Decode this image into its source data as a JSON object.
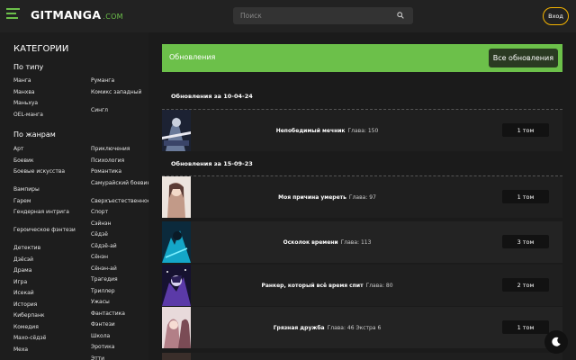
{
  "header": {
    "logo_main": "GITMANGA",
    "logo_suffix": ".COM",
    "search_placeholder": "Поиск",
    "login_label": "Вход"
  },
  "sidebar": {
    "title": "КАТЕГОРИИ",
    "by_type_title": "По типу",
    "by_type_left": [
      "Манга",
      "Манхва",
      "Маньхуа",
      "OEL-манга"
    ],
    "by_type_right": [
      "Руманга",
      "Комикс западный",
      "Сингл"
    ],
    "by_genre_title": "По жанрам",
    "genres_left": [
      "Арт",
      "Боевик",
      "Боевые искусства",
      "Вампиры",
      "Гарем",
      "Гендерная интрига",
      "Героическое фэнтези",
      "Детектив",
      "Дзёсэй",
      "Драма",
      "Игра",
      "Исекай",
      "История",
      "Киберпанк",
      "Комедия",
      "Махо-сёдзё",
      "Меха"
    ],
    "genres_right": [
      "Приключения",
      "Психология",
      "Романтика",
      "Самурайский боевик",
      "Сверхъестественное",
      "Спорт",
      "Сэйнэн",
      "Сёдзё",
      "Сёдзё-ай",
      "Сёнэн",
      "Сёнэн-ай",
      "Трагедия",
      "Триллер",
      "Ужасы",
      "Фантастика",
      "Фэнтези",
      "Школа",
      "Эротика",
      "Этти"
    ]
  },
  "main": {
    "updates_title": "Обновления",
    "all_updates_label": "Все обновления",
    "groups": [
      {
        "date_label": "Обновления за 10-04-24",
        "rows": [
          {
            "title": "Непобедимый мечник",
            "chapter_prefix": "Глава:",
            "chapter": "150",
            "volume": "1 том"
          }
        ]
      },
      {
        "date_label": "Обновления за 15-09-23",
        "rows": [
          {
            "title": "Моя причина умереть",
            "chapter_prefix": "Глава:",
            "chapter": "97",
            "volume": "1 том"
          },
          {
            "title": "Осколок времени",
            "chapter_prefix": "Глава:",
            "chapter": "113",
            "volume": "3 том"
          },
          {
            "title": "Ранкер, который всё время спит",
            "chapter_prefix": "Глава:",
            "chapter": "80",
            "volume": "2 том"
          },
          {
            "title": "Грязная дружба",
            "chapter_prefix": "Глава:",
            "chapter": "46 Экстра 6",
            "volume": "1 том"
          }
        ]
      }
    ]
  },
  "colors": {
    "accent": "#6cc04a",
    "login_border": "#f5b400",
    "background": "#1b1b1b"
  },
  "icons": {
    "menu": "hamburger-icon",
    "search": "search-icon",
    "theme": "moon-icon"
  }
}
